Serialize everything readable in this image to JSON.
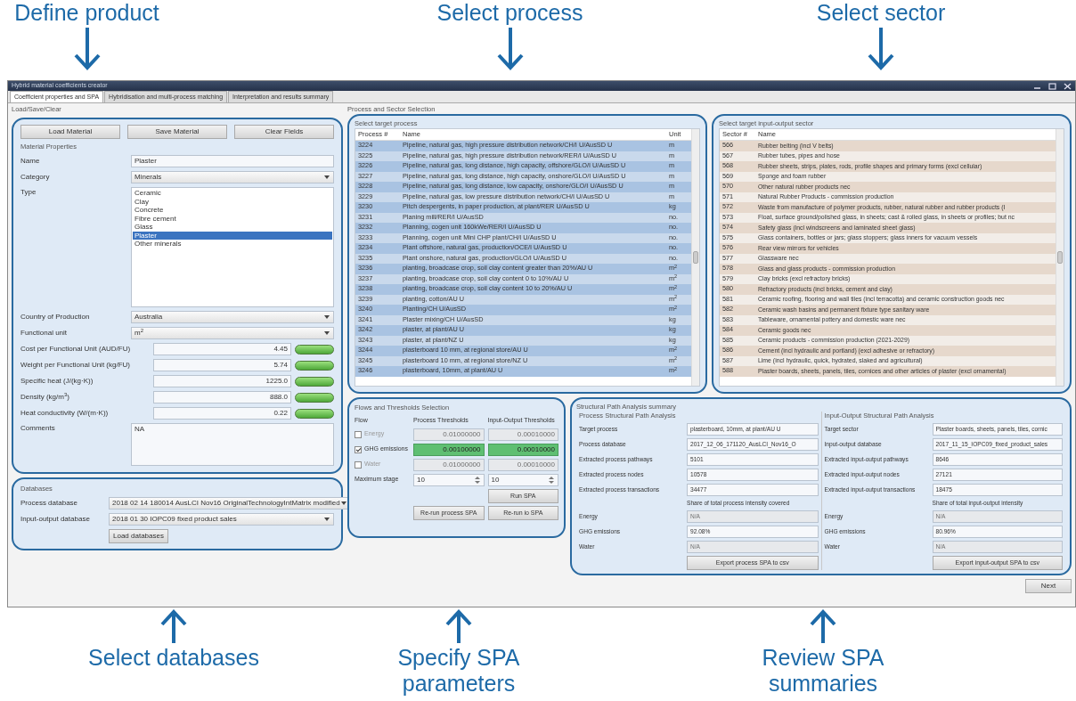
{
  "annotations_top": [
    {
      "label": "Define product"
    },
    {
      "label": "Select process"
    },
    {
      "label": "Select sector"
    }
  ],
  "window": {
    "title": "Hybrid material coefficients creator"
  },
  "tabs": [
    {
      "label": "Coefficient properties and SPA",
      "selected": true
    },
    {
      "label": "Hybridisation and multi-process matching",
      "selected": false
    },
    {
      "label": "Interpretation and results summary",
      "selected": false
    }
  ],
  "load_save_clear": {
    "title": "Load/Save/Clear",
    "buttons": [
      "Load Material",
      "Save Material",
      "Clear Fields"
    ]
  },
  "material_properties": {
    "title": "Material Properties",
    "name": {
      "label": "Name",
      "value": "Plaster"
    },
    "category": {
      "label": "Category",
      "value": "Minerals"
    },
    "type": {
      "label": "Type",
      "options": [
        {
          "label": "Ceramic",
          "selected": false
        },
        {
          "label": "Clay",
          "selected": false
        },
        {
          "label": "Concrete",
          "selected": false
        },
        {
          "label": "Fibre cement",
          "selected": false
        },
        {
          "label": "Glass",
          "selected": false
        },
        {
          "label": "Plaster",
          "selected": true
        },
        {
          "label": "Other minerals",
          "selected": false
        }
      ]
    },
    "country": {
      "label": "Country of Production",
      "value": "Australia"
    },
    "functional_unit": {
      "label": "Functional unit",
      "value": "m$^{2}$"
    },
    "values": [
      {
        "label": "Cost per Functional Unit (AUD/FU)",
        "value": "4.45",
        "valid": true
      },
      {
        "label": "Weight per Functional Unit (kg/FU)",
        "value": "5.74",
        "valid": true
      },
      {
        "label": "Specific heat (J/(kg·K))",
        "value": "1225.0",
        "valid": true
      },
      {
        "label": "Density (kg/m$^{3}$)",
        "value": "888.0",
        "valid": true
      },
      {
        "label": "Heat conductivity (W/(m·K))",
        "value": "0.22",
        "valid": true
      }
    ],
    "comments": {
      "label": "Comments",
      "value": "NA"
    }
  },
  "databases": {
    "title": "Databases",
    "fields": [
      {
        "label": "Process database",
        "value": "2018 02 14 180014 AusLCI Nov16 OriginalTechnologyIntMatrix modified"
      },
      {
        "label": "Input-output database",
        "value": "2018 01 30 IOPC09 fixed product sales"
      }
    ],
    "button": "Load databases"
  },
  "selection_title": "Process and Sector Selection",
  "process_table": {
    "title": "Select target process",
    "columns": [
      "Process #",
      "Name",
      "Unit"
    ],
    "rows": [
      [
        "3224",
        "Pipeline, natural gas, high pressure distribution network/CH/I U/AusSD U",
        "m"
      ],
      [
        "3225",
        "Pipeline, natural gas, high pressure distribution network/RER/I U/AusSD U",
        "m"
      ],
      [
        "3226",
        "Pipeline, natural gas, long distance, high capacity, offshore/GLO/I U/AusSD U",
        "m"
      ],
      [
        "3227",
        "Pipeline, natural gas, long distance, high capacity, onshore/GLO/I U/AusSD U",
        "m"
      ],
      [
        "3228",
        "Pipeline, natural gas, long distance, low capacity, onshore/GLO/I U/AusSD U",
        "m"
      ],
      [
        "3229",
        "Pipeline, natural gas, low pressure distribution network/CH/I U/AusSD U",
        "m"
      ],
      [
        "3230",
        "Pitch despergents, in paper production, at plant/RER U/AusSD U",
        "kg"
      ],
      [
        "3231",
        "Planing mill/RER/I U/AusSD",
        "no."
      ],
      [
        "3232",
        "Planning, cogen unit 160kWe/RER/I U/AusSD U",
        "no."
      ],
      [
        "3233",
        "Planning, cogen unit Mini CHP plant/CH/I U/AusSD U",
        "no."
      ],
      [
        "3234",
        "Plant offshore, natural gas, production/OCE/I U/AusSD U",
        "no."
      ],
      [
        "3235",
        "Plant onshore, natural gas, production/GLO/I U/AusSD U",
        "no."
      ],
      [
        "3236",
        "planting, broadcase crop, soil clay content greater than 20%/AU U",
        "m$^{2}$"
      ],
      [
        "3237",
        "planting, broadcase crop, soil clay content 0 to 10%/AU U",
        "m$^{2}$"
      ],
      [
        "3238",
        "planting, broadcase crop, soil clay content 10 to 20%/AU U",
        "m$^{2}$"
      ],
      [
        "3239",
        "planting, cotton/AU U",
        "m$^{2}$"
      ],
      [
        "3240",
        "Planting/CH U/AusSD",
        "m$^{2}$"
      ],
      [
        "3241",
        "Plaster mixing/CH U/AusSD",
        "kg"
      ],
      [
        "3242",
        "plaster, at plant/AU U",
        "kg"
      ],
      [
        "3243",
        "plaster, at plant/NZ U",
        "kg"
      ],
      [
        "3244",
        "plasterboard 10 mm, at regional store/AU U",
        "m$^{2}$"
      ],
      [
        "3245",
        "plasterboard 10 mm, at regional store/NZ U",
        "m$^{2}$"
      ],
      [
        "3246",
        "plasterboard, 10mm, at plant/AU U",
        "m$^{2}$"
      ]
    ]
  },
  "sector_table": {
    "title": "Select target input-output sector",
    "columns": [
      "Sector #",
      "Name"
    ],
    "rows": [
      [
        "566",
        "Rubber belting (incl V belts)"
      ],
      [
        "567",
        "Rubber tubes, pipes and hose"
      ],
      [
        "568",
        "Rubber sheets, strips, plates, rods, profile shapes and primary forms (excl cellular)"
      ],
      [
        "569",
        "Sponge and foam rubber"
      ],
      [
        "570",
        "Other natural rubber products nec"
      ],
      [
        "571",
        "Natural Rubber Products - commission production"
      ],
      [
        "572",
        "Waste from manufacture of polymer products, rubber, natural rubber and rubber products (I"
      ],
      [
        "573",
        "Float, surface ground/polished glass, in sheets; cast & rolled glass, in sheets or profiles; but nc"
      ],
      [
        "574",
        "Safety glass (incl windscreens and laminated sheet glass)"
      ],
      [
        "575",
        "Glass containers, bottles or jars; glass stoppers; glass inners for vacuum vessels"
      ],
      [
        "576",
        "Rear view mirrors for vehicles"
      ],
      [
        "577",
        "Glassware nec"
      ],
      [
        "578",
        "Glass and glass products - commission production"
      ],
      [
        "579",
        "Clay bricks (excl refractory bricks)"
      ],
      [
        "580",
        "Refractory products (incl bricks, cement and clay)"
      ],
      [
        "581",
        "Ceramic roofing, flooring and wall tiles (incl terracotta) and ceramic construction goods nec"
      ],
      [
        "582",
        "Ceramic wash basins and permanent fixture type sanitary ware"
      ],
      [
        "583",
        "Tableware, ornamental pottery and domestic ware nec"
      ],
      [
        "584",
        "Ceramic goods nec"
      ],
      [
        "585",
        "Ceramic products - commission production (2021-2029)"
      ],
      [
        "586",
        "Cement (incl hydraulic and portland) (excl adhesive or refractory)"
      ],
      [
        "587",
        "Lime (incl hydraulic, quick, hydrated, slaked and agricultural)"
      ],
      [
        "588",
        "Plaster boards, sheets, panels, tiles, cornices and other articles of plaster (excl ornamental)"
      ]
    ]
  },
  "flows": {
    "title": "Flows and Thresholds Selection",
    "columns": [
      "Flow",
      "Process Thresholds",
      "Input-Output Thresholds"
    ],
    "rows": [
      {
        "label": "Energy",
        "checked": false,
        "process": "0.01000000",
        "io": "0.00010000"
      },
      {
        "label": "GHG emissions",
        "checked": true,
        "process": "0.00100000",
        "io": "0.00010000"
      },
      {
        "label": "Water",
        "checked": false,
        "process": "0.01000000",
        "io": "0.00010000"
      }
    ],
    "max_stage": {
      "label": "Maximum stage",
      "process": "10",
      "io": "10"
    },
    "run_button": "Run SPA",
    "rerun_buttons": [
      "Re-run process SPA",
      "Re-run io SPA"
    ]
  },
  "spa_summary": {
    "title": "Structural Path Analysis summary",
    "sections": [
      {
        "title": "Process Structural Path Analysis",
        "fields": [
          {
            "label": "Target process",
            "value": "plasterboard, 10mm, at plant/AU U"
          },
          {
            "label": "Process database",
            "value": "2017_12_06_171120_AusLCI_Nov16_O"
          },
          {
            "label": "Extracted process pathways",
            "value": "5101"
          },
          {
            "label": "Extracted process nodes",
            "value": "10578"
          },
          {
            "label": "Extracted process transactions",
            "value": "34477"
          }
        ],
        "share_label": "Share of total process intensity covered",
        "flows": [
          {
            "label": "Energy",
            "value": "N/A",
            "disabled": true
          },
          {
            "label": "GHG emissions",
            "value": "92.08%",
            "disabled": false
          },
          {
            "label": "Water",
            "value": "N/A",
            "disabled": true
          }
        ],
        "button": "Export process SPA to csv"
      },
      {
        "title": "Input-Output Structural Path Analysis",
        "fields": [
          {
            "label": "Target sector",
            "value": "Plaster boards, sheets, panels, tiles, cornic"
          },
          {
            "label": "Input-output database",
            "value": "2017_11_15_IOPC09_fixed_product_sales"
          },
          {
            "label": "Extracted input-output pathways",
            "value": "8646"
          },
          {
            "label": "Extracted input-output nodes",
            "value": "27121"
          },
          {
            "label": "Extracted input-output transactions",
            "value": "18475"
          }
        ],
        "share_label": "Share of total input-output intensity",
        "flows": [
          {
            "label": "Energy",
            "value": "N/A",
            "disabled": true
          },
          {
            "label": "GHG emissions",
            "value": "80.96%",
            "disabled": false
          },
          {
            "label": "Water",
            "value": "N/A",
            "disabled": true
          }
        ],
        "button": "Export input-output SPA to csv"
      }
    ]
  },
  "next_button": "Next",
  "annotations_bottom": [
    {
      "label": "Select databases"
    },
    {
      "label": "Specify SPA parameters"
    },
    {
      "label": "Review SPA summaries"
    }
  ]
}
